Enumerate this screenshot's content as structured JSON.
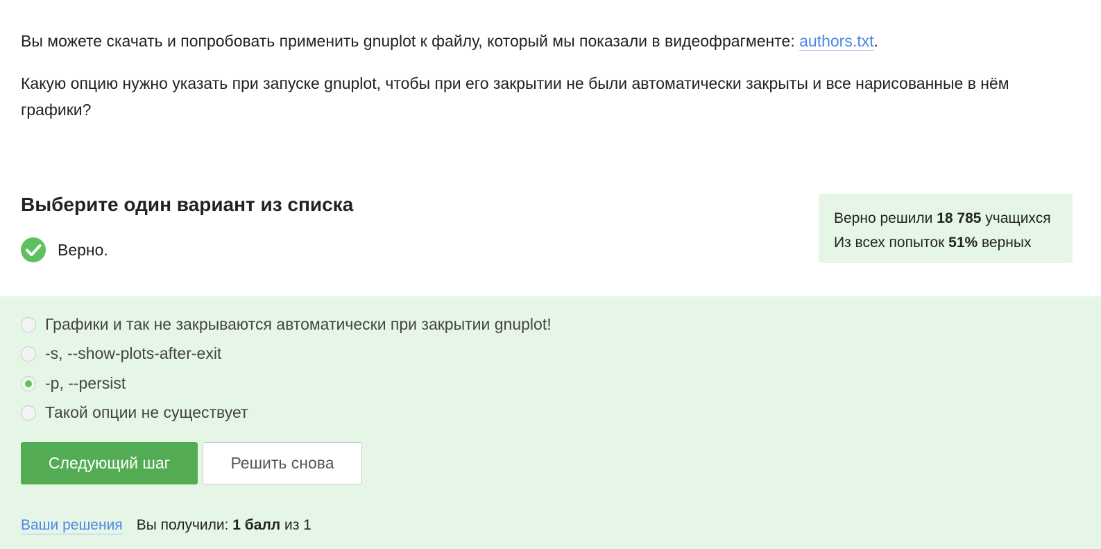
{
  "question": {
    "line1_text": "Вы можете скачать и попробовать применить gnuplot к файлу, который мы показали в видеофрагменте: ",
    "line1_link": "authors.txt",
    "line1_end": ".",
    "line2_text": "Какую опцию нужно указать при запуске gnuplot, чтобы при его закрытии не были автоматически закрыты и все нарисованные в нём графики?"
  },
  "instruction": "Выберите один вариант из списка",
  "verdict": "Верно.",
  "stats": {
    "solved_prefix": "Верно решили ",
    "solved_count": "18 785",
    "solved_suffix": " учащихся",
    "attempts_prefix": "Из всех попыток ",
    "attempts_percent": "51%",
    "attempts_suffix": " верных"
  },
  "options": [
    {
      "label": "Графики и так не закрываются автоматически при закрытии gnuplot!",
      "selected": false
    },
    {
      "label": "-s, --show-plots-after-exit",
      "selected": false
    },
    {
      "label": "-p, --persist",
      "selected": true
    },
    {
      "label": "Такой опции не существует",
      "selected": false
    }
  ],
  "buttons": {
    "next_label": "Следующий шаг",
    "retry_label": "Решить снова"
  },
  "footer": {
    "solutions_link": "Ваши решения",
    "score_prefix": "Вы получили: ",
    "score_value": "1 балл",
    "score_suffix": " из 1"
  },
  "colors": {
    "accent_green": "#5ec15e",
    "button_green": "#53ac53",
    "panel_green": "#e6f6e6",
    "link_blue": "#4a86e8"
  }
}
